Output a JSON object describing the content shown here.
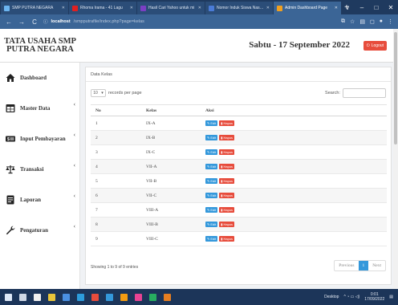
{
  "browser": {
    "tabs": [
      {
        "title": "SMP PUTRA NEGARA",
        "color": "#6bb4f0",
        "active": false
      },
      {
        "title": "Rhoma Irama - 41 Lagu",
        "color": "#e02020",
        "active": false
      },
      {
        "title": "Hasil Cari Yahoo untuk mi",
        "color": "#7b3fc4",
        "active": false
      },
      {
        "title": "Nomor Induk Siswa Nasional",
        "color": "#4a7bd6",
        "active": false
      },
      {
        "title": "Admin Dashboard Page",
        "color": "#f0a020",
        "active": true
      }
    ],
    "new_tab": "+",
    "window_controls": [
      "v",
      "–",
      "□",
      "✕"
    ],
    "back": "←",
    "forward": "→",
    "reload": "C",
    "info_icon": "ⓘ",
    "url_host": "localhost",
    "url_path": "/smpputrafile/index.php?page=kelas",
    "tools": [
      "⧉",
      "☆",
      "▤",
      "◻",
      "●",
      "⋮"
    ]
  },
  "header": {
    "brand_line1": "TATA USAHA SMP",
    "brand_line2": "PUTRA NEGARA",
    "date": "Sabtu - 17 September 2022",
    "logout_label": "Logout",
    "logout_icon": "⏻"
  },
  "sidebar": {
    "items": [
      {
        "label": "Dashboard",
        "icon": "home-icon",
        "chevron": ""
      },
      {
        "label": "Master Data",
        "icon": "table-icon",
        "chevron": "‹"
      },
      {
        "label": "Input Pembayaran",
        "icon": "money-icon",
        "chevron": "‹"
      },
      {
        "label": "Transaksi",
        "icon": "balance-scale-icon",
        "chevron": "‹"
      },
      {
        "label": "Laporan",
        "icon": "report-icon",
        "chevron": "‹"
      },
      {
        "label": "Pengaturan",
        "icon": "wrench-icon",
        "chevron": "‹"
      }
    ]
  },
  "card": {
    "title": "Data Kelas",
    "perpage_value": "10",
    "perpage_arrow": "▾",
    "perpage_label": "records per page",
    "search_label": "Search:",
    "columns": [
      "No",
      "Kelas",
      "Aksi"
    ],
    "edit_label": "Edit",
    "delete_label": "Hapus",
    "rows": [
      {
        "no": "1",
        "kelas": "IX-A"
      },
      {
        "no": "2",
        "kelas": "IX-B"
      },
      {
        "no": "3",
        "kelas": "IX-C"
      },
      {
        "no": "4",
        "kelas": "VII-A"
      },
      {
        "no": "5",
        "kelas": "VII-B"
      },
      {
        "no": "6",
        "kelas": "VII-C"
      },
      {
        "no": "7",
        "kelas": "VIII-A"
      },
      {
        "no": "8",
        "kelas": "VIII-B"
      },
      {
        "no": "9",
        "kelas": "VIII-C"
      }
    ],
    "info": "Showing 1 to 9 of 9 entries",
    "pager": {
      "previous": "Previous",
      "current": "1",
      "next": "Next"
    }
  },
  "taskbar": {
    "icons": [
      {
        "name": "windows-icon",
        "color": "#dfe9f7"
      },
      {
        "name": "search-icon",
        "color": "#cfd8e6"
      },
      {
        "name": "app-icon",
        "color": "#f0f0f0"
      },
      {
        "name": "chrome-icon",
        "color": "#e8c53a"
      },
      {
        "name": "app-icon",
        "color": "#4a90e2"
      },
      {
        "name": "app-icon",
        "color": "#2d9cdb"
      },
      {
        "name": "app-icon",
        "color": "#e74c3c"
      },
      {
        "name": "app-icon",
        "color": "#3498db"
      },
      {
        "name": "app-icon",
        "color": "#f39c12"
      },
      {
        "name": "app-icon",
        "color": "#e84393"
      },
      {
        "name": "app-icon",
        "color": "#27ae60"
      },
      {
        "name": "app-icon",
        "color": "#e67e22"
      }
    ],
    "desktop_label": "Desktop",
    "time": "0:01",
    "date": "17/09/2022"
  }
}
